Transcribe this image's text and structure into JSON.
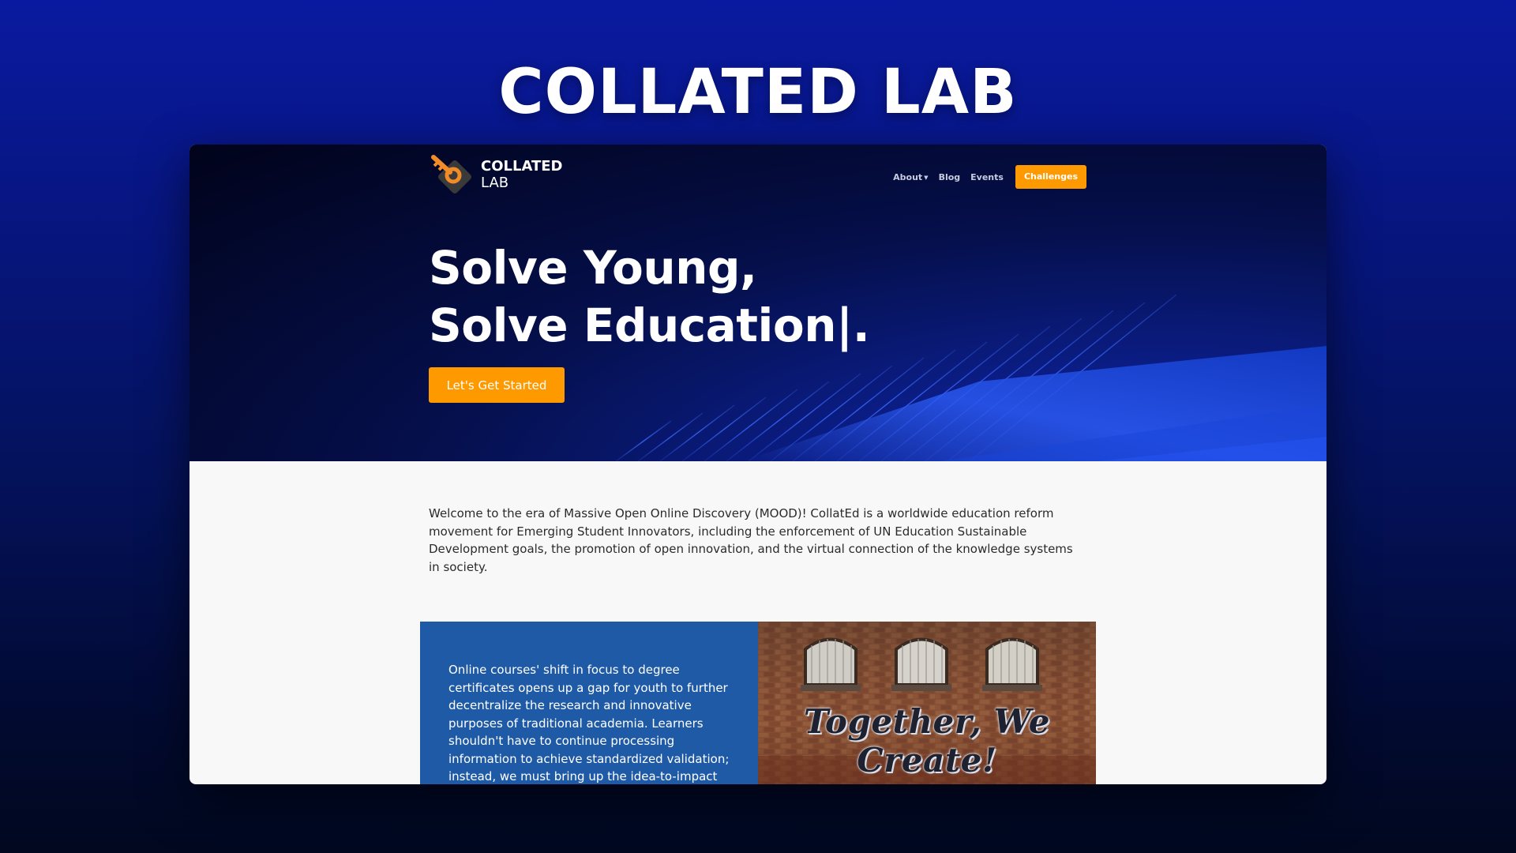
{
  "banner": {
    "title": "COLLATED LAB"
  },
  "site": {
    "logo": {
      "line1": "COLLATED",
      "line2": "LAB"
    },
    "nav": {
      "about": "About",
      "blog": "Blog",
      "events": "Events",
      "cta": "Challenges",
      "about_icon": "caret-down-icon"
    },
    "hero": {
      "headline_line1": "Solve Young,",
      "headline_line2": "Solve Education|.",
      "cta": "Let's Get Started"
    },
    "intro": "Welcome to the era of Massive Open Online Discovery (MOOD)! CollatEd is a worldwide education reform movement for Emerging Student Innovators, including the enforcement of UN Education Sustainable Development goals, the promotion of open innovation, and the virtual connection of the knowledge systems in society.",
    "feature": {
      "text": "Online courses' shift in focus to degree certificates opens up a gap for youth to further decentralize the research and innovative purposes of traditional academia. Learners shouldn't have to continue processing information to achieve standardized validation; instead, we must bring up the idea-to-impact",
      "image_caption": "Together, We Create!"
    }
  },
  "colors": {
    "accent": "#ff9900",
    "feature_panel": "#1f5aa6",
    "hero_dark": "#01031a",
    "hero_blue": "#1636b8"
  }
}
